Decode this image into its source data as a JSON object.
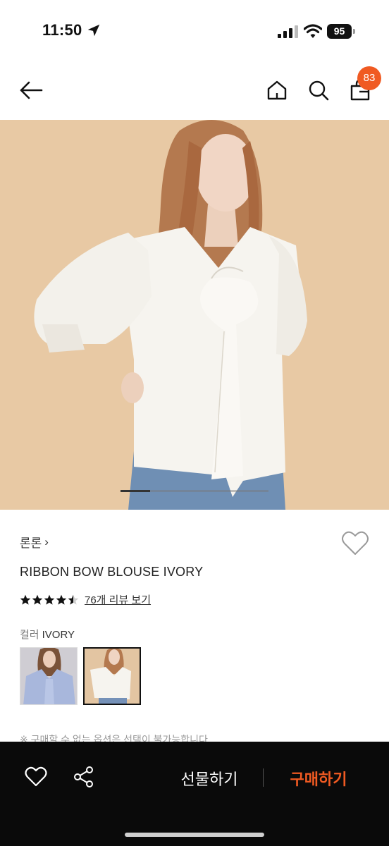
{
  "status_bar": {
    "time": "11:50",
    "battery": "95"
  },
  "nav": {
    "cart_count": "83",
    "icons": [
      "back-arrow-icon",
      "home-icon",
      "search-icon",
      "shopping-bag-icon"
    ]
  },
  "carousel": {
    "current_index": 1,
    "total": 5
  },
  "product": {
    "brand": "론론",
    "brand_chevron": "›",
    "title": "RIBBON BOW BLOUSE IVORY",
    "rating": 4.5,
    "review_link": "76개 리뷰 보기",
    "color_label": "컬러",
    "color_value": "IVORY",
    "swatches": [
      "blue",
      "ivory"
    ],
    "selected_swatch": "ivory",
    "notice": "※ 구매할 수 없는 옵션은 선택이 불가능합니다"
  },
  "action_bar": {
    "gift_label": "선물하기",
    "buy_label": "구매하기"
  },
  "colors": {
    "accent": "#f05a22",
    "bar_background": "#0a0a0a",
    "hero_background": "#e8c9a4"
  }
}
